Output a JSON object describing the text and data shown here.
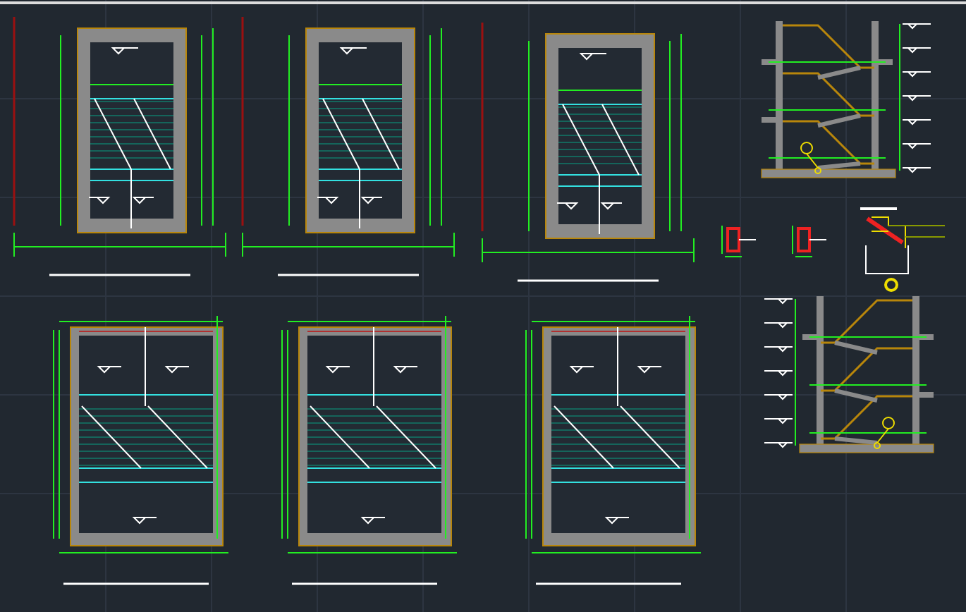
{
  "sheet": {
    "plans": [
      {
        "kind": "narrow"
      },
      {
        "kind": "narrow"
      },
      {
        "kind": "narrow"
      },
      {
        "kind": "wide"
      },
      {
        "kind": "wide"
      },
      {
        "kind": "wide"
      }
    ],
    "sections": [
      {
        "kind": "section",
        "flipped": false
      },
      {
        "kind": "section",
        "flipped": true
      }
    ],
    "details": [
      {
        "kind": "column"
      },
      {
        "kind": "column"
      },
      {
        "kind": "beam"
      }
    ]
  }
}
